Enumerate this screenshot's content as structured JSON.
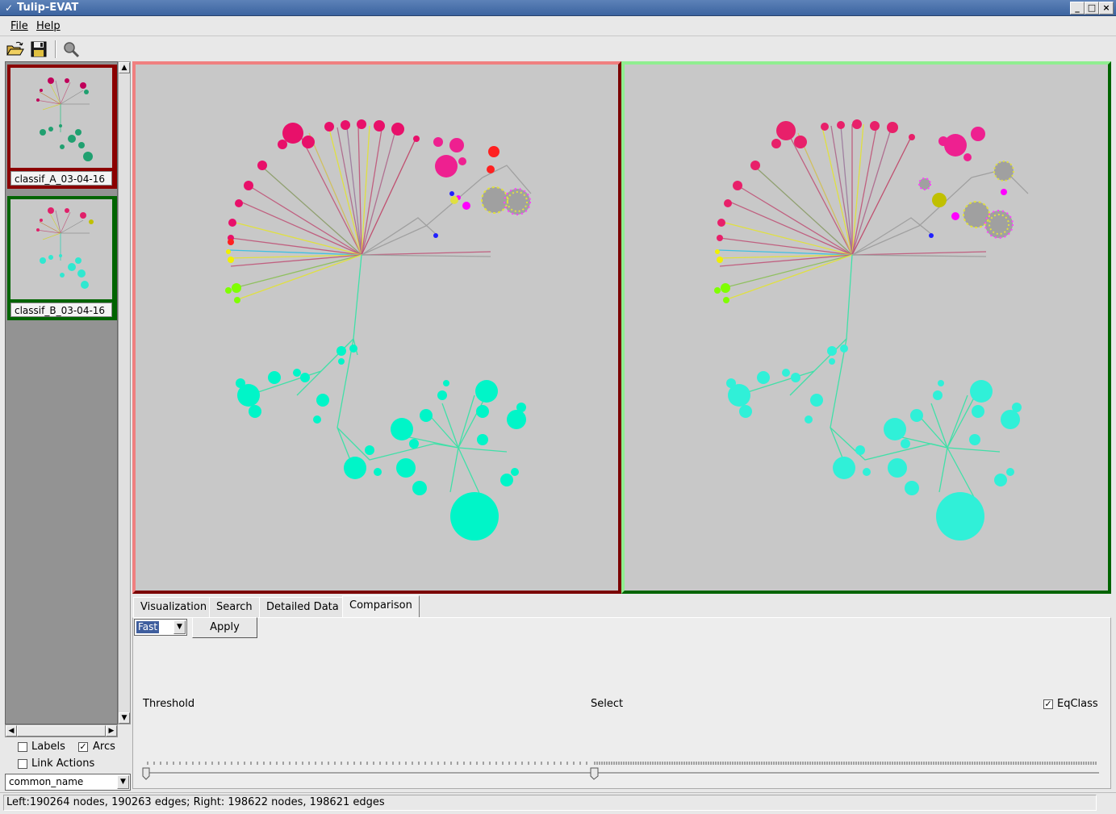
{
  "window": {
    "title": "Tulip-EVAT"
  },
  "menu": {
    "file": "File",
    "help": "Help"
  },
  "toolbar": {
    "open": "folder-open-icon",
    "save": "floppy-disk-icon",
    "search": "magnifier-icon"
  },
  "thumbnails": [
    {
      "label": "classif_A_03-04-16",
      "border": "#8b0000"
    },
    {
      "label": "classif_B_03-04-16",
      "border": "#006400"
    }
  ],
  "options": {
    "labels": "Labels",
    "labels_checked": false,
    "arcs": "Arcs",
    "arcs_checked": true,
    "link_actions": "Link Actions",
    "link_actions_checked": false
  },
  "property_select": {
    "value": "common_name"
  },
  "tabs": [
    "Visualization",
    "Search",
    "Detailed Data",
    "Comparison"
  ],
  "active_tab": "Comparison",
  "comparison": {
    "mode": "Fast",
    "apply": "Apply",
    "threshold": "Threshold",
    "select": "Select",
    "eqclass": "EqClass",
    "eqclass_checked": true
  },
  "status": "Left:190264 nodes, 190263 edges; Right: 198622 nodes, 198621 edges",
  "colors": {
    "cyan_cluster": "#00f5c8",
    "magenta": "#ff1493",
    "left_border": "#f08080",
    "right_border": "#90ee90",
    "edge": "#a0a0a0"
  }
}
